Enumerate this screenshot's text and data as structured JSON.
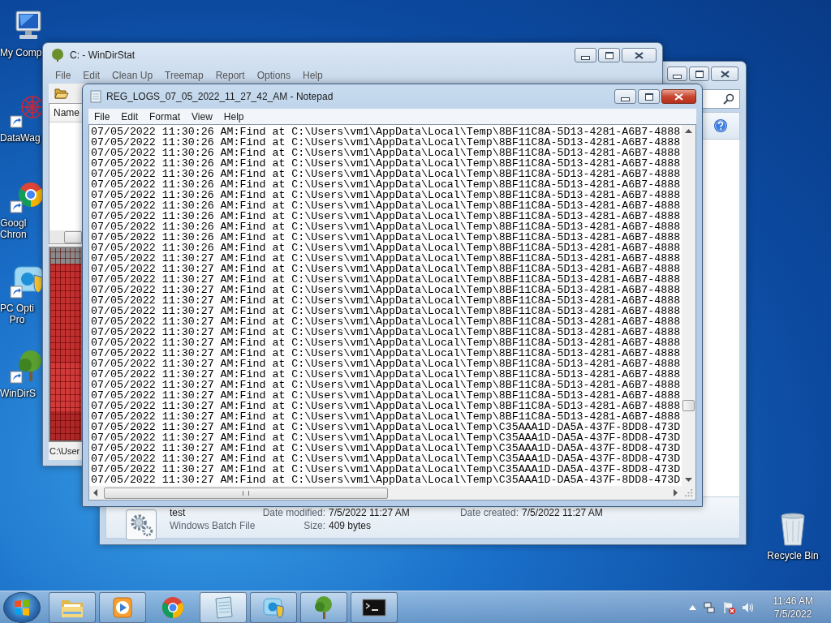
{
  "desktop_icons": [
    {
      "kind": "computer",
      "label": [
        "My Comp"
      ]
    },
    {
      "kind": "datawag",
      "label": [
        "DataWag"
      ]
    },
    {
      "kind": "chrome",
      "label": [
        "Googl",
        "Chron"
      ]
    },
    {
      "kind": "optimizer",
      "label": [
        "PC Opti",
        "Pro"
      ]
    },
    {
      "kind": "tree",
      "label": [
        "WinDirS"
      ]
    }
  ],
  "recycle_bin": {
    "label": "Recycle Bin"
  },
  "explorer": {
    "details": [
      {
        "text": "test",
        "fields": [
          {
            "label": "Date modified:",
            "value": "7/5/2022 11:27 AM"
          },
          {
            "label": "Date created:",
            "value": "7/5/2022 11:27 AM"
          }
        ]
      },
      {
        "text": "Windows Batch File",
        "fields": [
          {
            "label": "Size:",
            "value": "409 bytes"
          }
        ]
      }
    ]
  },
  "windirstat": {
    "title": "C: - WinDirStat",
    "menu": [
      "File",
      "Edit",
      "Clean Up",
      "Treemap",
      "Report",
      "Options",
      "Help"
    ],
    "column_header": "Name",
    "status": "C:\\User"
  },
  "notepad": {
    "title": "REG_LOGS_07_05_2022_11_27_42_AM - Notepad",
    "menu": [
      "File",
      "Edit",
      "Format",
      "View",
      "Help"
    ],
    "lines": [
      "07/05/2022 11:30:26 AM:Find at C:\\Users\\vm1\\AppData\\Local\\Temp\\8BF11C8A-5D13-4281-A6B7-4888",
      "07/05/2022 11:30:26 AM:Find at C:\\Users\\vm1\\AppData\\Local\\Temp\\8BF11C8A-5D13-4281-A6B7-4888",
      "07/05/2022 11:30:26 AM:Find at C:\\Users\\vm1\\AppData\\Local\\Temp\\8BF11C8A-5D13-4281-A6B7-4888",
      "07/05/2022 11:30:26 AM:Find at C:\\Users\\vm1\\AppData\\Local\\Temp\\8BF11C8A-5D13-4281-A6B7-4888",
      "07/05/2022 11:30:26 AM:Find at C:\\Users\\vm1\\AppData\\Local\\Temp\\8BF11C8A-5D13-4281-A6B7-4888",
      "07/05/2022 11:30:26 AM:Find at C:\\Users\\vm1\\AppData\\Local\\Temp\\8BF11C8A-5D13-4281-A6B7-4888",
      "07/05/2022 11:30:26 AM:Find at C:\\Users\\vm1\\AppData\\Local\\Temp\\8BF11C8A-5D13-4281-A6B7-4888",
      "07/05/2022 11:30:26 AM:Find at C:\\Users\\vm1\\AppData\\Local\\Temp\\8BF11C8A-5D13-4281-A6B7-4888",
      "07/05/2022 11:30:26 AM:Find at C:\\Users\\vm1\\AppData\\Local\\Temp\\8BF11C8A-5D13-4281-A6B7-4888",
      "07/05/2022 11:30:26 AM:Find at C:\\Users\\vm1\\AppData\\Local\\Temp\\8BF11C8A-5D13-4281-A6B7-4888",
      "07/05/2022 11:30:26 AM:Find at C:\\Users\\vm1\\AppData\\Local\\Temp\\8BF11C8A-5D13-4281-A6B7-4888",
      "07/05/2022 11:30:26 AM:Find at C:\\Users\\vm1\\AppData\\Local\\Temp\\8BF11C8A-5D13-4281-A6B7-4888",
      "07/05/2022 11:30:27 AM:Find at C:\\Users\\vm1\\AppData\\Local\\Temp\\8BF11C8A-5D13-4281-A6B7-4888",
      "07/05/2022 11:30:27 AM:Find at C:\\Users\\vm1\\AppData\\Local\\Temp\\8BF11C8A-5D13-4281-A6B7-4888",
      "07/05/2022 11:30:27 AM:Find at C:\\Users\\vm1\\AppData\\Local\\Temp\\8BF11C8A-5D13-4281-A6B7-4888",
      "07/05/2022 11:30:27 AM:Find at C:\\Users\\vm1\\AppData\\Local\\Temp\\8BF11C8A-5D13-4281-A6B7-4888",
      "07/05/2022 11:30:27 AM:Find at C:\\Users\\vm1\\AppData\\Local\\Temp\\8BF11C8A-5D13-4281-A6B7-4888",
      "07/05/2022 11:30:27 AM:Find at C:\\Users\\vm1\\AppData\\Local\\Temp\\8BF11C8A-5D13-4281-A6B7-4888",
      "07/05/2022 11:30:27 AM:Find at C:\\Users\\vm1\\AppData\\Local\\Temp\\8BF11C8A-5D13-4281-A6B7-4888",
      "07/05/2022 11:30:27 AM:Find at C:\\Users\\vm1\\AppData\\Local\\Temp\\8BF11C8A-5D13-4281-A6B7-4888",
      "07/05/2022 11:30:27 AM:Find at C:\\Users\\vm1\\AppData\\Local\\Temp\\8BF11C8A-5D13-4281-A6B7-4888",
      "07/05/2022 11:30:27 AM:Find at C:\\Users\\vm1\\AppData\\Local\\Temp\\8BF11C8A-5D13-4281-A6B7-4888",
      "07/05/2022 11:30:27 AM:Find at C:\\Users\\vm1\\AppData\\Local\\Temp\\8BF11C8A-5D13-4281-A6B7-4888",
      "07/05/2022 11:30:27 AM:Find at C:\\Users\\vm1\\AppData\\Local\\Temp\\8BF11C8A-5D13-4281-A6B7-4888",
      "07/05/2022 11:30:27 AM:Find at C:\\Users\\vm1\\AppData\\Local\\Temp\\8BF11C8A-5D13-4281-A6B7-4888",
      "07/05/2022 11:30:27 AM:Find at C:\\Users\\vm1\\AppData\\Local\\Temp\\8BF11C8A-5D13-4281-A6B7-4888",
      "07/05/2022 11:30:27 AM:Find at C:\\Users\\vm1\\AppData\\Local\\Temp\\8BF11C8A-5D13-4281-A6B7-4888",
      "07/05/2022 11:30:27 AM:Find at C:\\Users\\vm1\\AppData\\Local\\Temp\\8BF11C8A-5D13-4281-A6B7-4888",
      "07/05/2022 11:30:27 AM:Find at C:\\Users\\vm1\\AppData\\Local\\Temp\\C35AAA1D-DA5A-437F-8DD8-473D",
      "07/05/2022 11:30:27 AM:Find at C:\\Users\\vm1\\AppData\\Local\\Temp\\C35AAA1D-DA5A-437F-8DD8-473D",
      "07/05/2022 11:30:27 AM:Find at C:\\Users\\vm1\\AppData\\Local\\Temp\\C35AAA1D-DA5A-437F-8DD8-473D",
      "07/05/2022 11:30:27 AM:Find at C:\\Users\\vm1\\AppData\\Local\\Temp\\C35AAA1D-DA5A-437F-8DD8-473D",
      "07/05/2022 11:30:27 AM:Find at C:\\Users\\vm1\\AppData\\Local\\Temp\\C35AAA1D-DA5A-437F-8DD8-473D",
      "07/05/2022 11:30:27 AM:Find at C:\\Users\\vm1\\AppData\\Local\\Temp\\C35AAA1D-DA5A-437F-8DD8-473D"
    ]
  },
  "taskbar": {
    "items": [
      {
        "kind": "explorer",
        "running": true,
        "active": false
      },
      {
        "kind": "media",
        "running": true,
        "active": false
      },
      {
        "kind": "chrome",
        "running": false,
        "active": false
      },
      {
        "kind": "notepad",
        "running": true,
        "active": true
      },
      {
        "kind": "optimizer",
        "running": true,
        "active": false
      },
      {
        "kind": "tree",
        "running": true,
        "active": false
      },
      {
        "kind": "cmd",
        "running": true,
        "active": false
      }
    ],
    "clock": {
      "time": "11:46 AM",
      "date": "7/5/2022"
    }
  }
}
